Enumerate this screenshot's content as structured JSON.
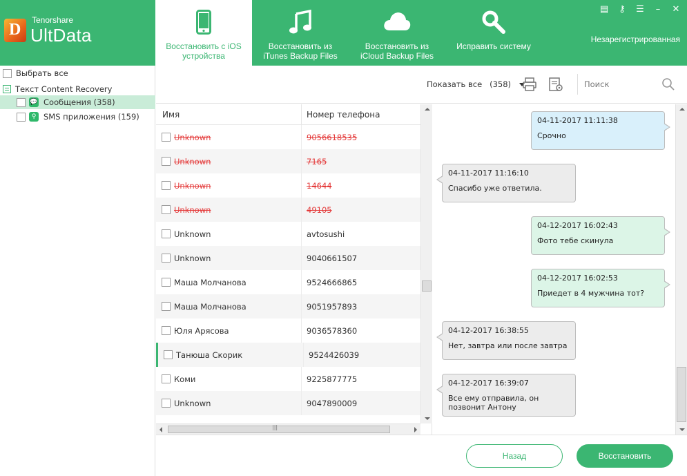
{
  "app": {
    "brand_small": "Tenorshare",
    "brand_big": "UltData",
    "logo_letter": "D",
    "unregistered": "Незарегистрированная",
    "accent_color": "#3bb672"
  },
  "tabs": [
    {
      "line1": "Восстановить с iOS",
      "line2": "устройства",
      "icon": "phone-icon",
      "active": true
    },
    {
      "line1": "Восстановить из",
      "line2": "iTunes Backup Files",
      "icon": "music-note-icon",
      "active": false
    },
    {
      "line1": "Восстановить из",
      "line2": "iCloud Backup Files",
      "icon": "cloud-icon",
      "active": false
    },
    {
      "line1": "Исправить систему",
      "line2": "",
      "icon": "wrench-icon",
      "active": false
    }
  ],
  "sidebar": {
    "select_all": "Выбрать все",
    "group": "Текст Content Recovery",
    "items": [
      {
        "label": "Сообщения (358)",
        "icon": "message-icon",
        "selected": true
      },
      {
        "label": "SMS приложения (159)",
        "icon": "attachment-icon",
        "selected": false
      }
    ]
  },
  "toolbar": {
    "filter_label": "Показать все",
    "filter_count": "(358)",
    "search_placeholder": "Поиск"
  },
  "table": {
    "col_name": "Имя",
    "col_phone": "Номер телефона",
    "rows": [
      {
        "name": "Unknown",
        "phone": "9056618535",
        "deleted": true
      },
      {
        "name": "Unknown",
        "phone": "7165",
        "deleted": true
      },
      {
        "name": "Unknown",
        "phone": "14644",
        "deleted": true
      },
      {
        "name": "Unknown",
        "phone": "49105",
        "deleted": true
      },
      {
        "name": "Unknown",
        "phone": "avtosushi",
        "deleted": false
      },
      {
        "name": "Unknown",
        "phone": "9040661507",
        "deleted": false
      },
      {
        "name": "Маша Молчанова",
        "phone": "9524666865",
        "deleted": false
      },
      {
        "name": "Маша Молчанова",
        "phone": "9051957893",
        "deleted": false
      },
      {
        "name": "Юля Арясова",
        "phone": "9036578360",
        "deleted": false
      },
      {
        "name": "Танюша Скорик",
        "phone": "9524426039",
        "deleted": false
      },
      {
        "name": "Коми",
        "phone": "9225877775",
        "deleted": false
      },
      {
        "name": "Unknown",
        "phone": "9047890009",
        "deleted": false
      }
    ]
  },
  "messages": [
    {
      "dir": "out",
      "color": "blue",
      "time": "04-11-2017 11:11:38",
      "text": "Срочно"
    },
    {
      "dir": "in",
      "time": "04-11-2017 11:16:10",
      "text": "Спасибо уже ответила."
    },
    {
      "dir": "out",
      "color": "green",
      "time": "04-12-2017 16:02:43",
      "text": "Фото тебе скинула"
    },
    {
      "dir": "out",
      "color": "green",
      "time": "04-12-2017 16:02:53",
      "text": "Приедет в 4 мужчина тот?"
    },
    {
      "dir": "in",
      "time": "04-12-2017 16:38:55",
      "text": "Нет, завтра или после завтра"
    },
    {
      "dir": "in",
      "time": "04-12-2017 16:39:07",
      "text": "Все ему отправила, он позвонит Антону"
    }
  ],
  "footer": {
    "back": "Назад",
    "recover": "Восстановить"
  }
}
